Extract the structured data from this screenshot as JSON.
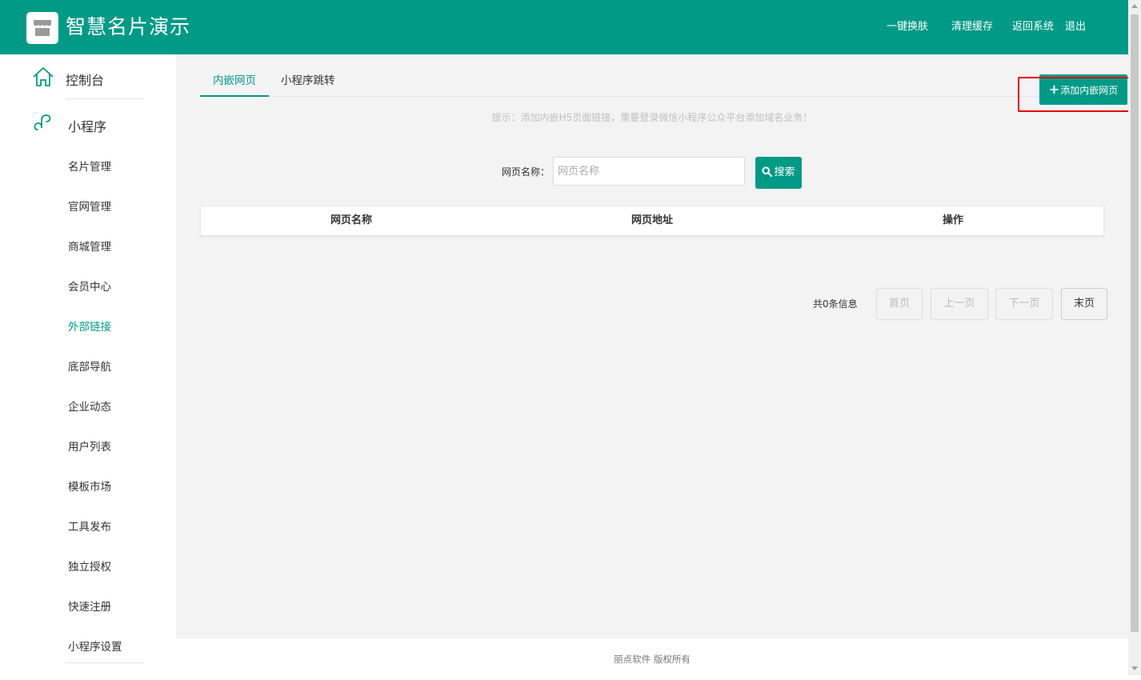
{
  "header": {
    "title": "智慧名片演示",
    "links": [
      "一键换肤",
      "清理缓存",
      "返回系统",
      "退出"
    ]
  },
  "sidebar": {
    "major": [
      {
        "label": "控制台",
        "icon": "home-icon"
      },
      {
        "label": "小程序",
        "icon": "miniprogram-icon"
      }
    ],
    "items": [
      {
        "label": "名片管理"
      },
      {
        "label": "官网管理"
      },
      {
        "label": "商城管理"
      },
      {
        "label": "会员中心"
      },
      {
        "label": "外部链接",
        "active": true
      },
      {
        "label": "底部导航"
      },
      {
        "label": "企业动态"
      },
      {
        "label": "用户列表"
      },
      {
        "label": "模板市场"
      },
      {
        "label": "工具发布"
      },
      {
        "label": "独立授权"
      },
      {
        "label": "快速注册"
      },
      {
        "label": "小程序设置"
      }
    ]
  },
  "main": {
    "tabs": [
      {
        "label": "内嵌网页",
        "active": true
      },
      {
        "label": "小程序跳转"
      }
    ],
    "add_button": "添加内嵌网页",
    "hint": "提示：添加内嵌H5页面链接，需要登录微信小程序公众平台添加域名业务！",
    "search": {
      "label": "网页名称：",
      "placeholder": "网页名称",
      "value": "",
      "button": "搜索"
    },
    "table": {
      "headers": [
        "网页名称",
        "网页地址",
        "操作"
      ],
      "rows": []
    },
    "pager": {
      "total": "共0条信息",
      "first": "首页",
      "prev": "上一页",
      "next": "下一页",
      "last": "末页"
    }
  },
  "footer": "丽点软件 版权所有",
  "colors": {
    "brand": "#009a86",
    "highlight": "#e60000",
    "background": "#f3f3f4"
  }
}
